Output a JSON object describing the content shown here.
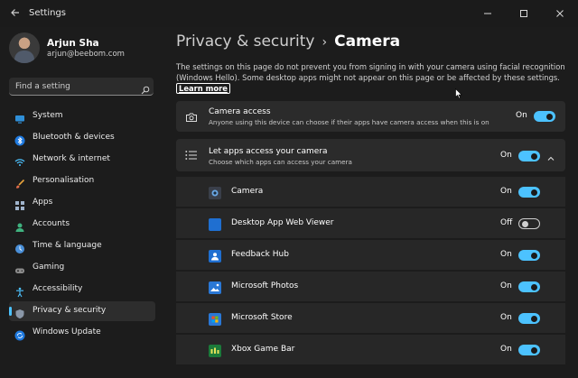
{
  "window": {
    "title": "Settings"
  },
  "user": {
    "name": "Arjun Sha",
    "email": "arjun@beebom.com"
  },
  "search": {
    "placeholder": "Find a setting"
  },
  "sidebar": {
    "items": [
      {
        "label": "System",
        "icon": "monitor-icon"
      },
      {
        "label": "Bluetooth & devices",
        "icon": "bluetooth-icon"
      },
      {
        "label": "Network & internet",
        "icon": "wifi-icon"
      },
      {
        "label": "Personalisation",
        "icon": "brush-icon"
      },
      {
        "label": "Apps",
        "icon": "apps-grid-icon"
      },
      {
        "label": "Accounts",
        "icon": "person-icon"
      },
      {
        "label": "Time & language",
        "icon": "globe-clock-icon"
      },
      {
        "label": "Gaming",
        "icon": "gamepad-icon"
      },
      {
        "label": "Accessibility",
        "icon": "accessibility-icon"
      },
      {
        "label": "Privacy & security",
        "icon": "shield-icon",
        "active": true
      },
      {
        "label": "Windows Update",
        "icon": "update-icon"
      }
    ]
  },
  "breadcrumb": {
    "parent": "Privacy & security",
    "separator": "›",
    "current": "Camera"
  },
  "description": {
    "text": "The settings on this page do not prevent you from signing in with your camera using facial recognition (Windows Hello). Some desktop apps might not appear on this page or be affected by these settings.",
    "link": "Learn more"
  },
  "camera_access": {
    "title": "Camera access",
    "subtitle": "Anyone using this device can choose if their apps have camera access when this is on",
    "state": "On"
  },
  "apps_access": {
    "title": "Let apps access your camera",
    "subtitle": "Choose which apps can access your camera",
    "state": "On"
  },
  "apps": [
    {
      "name": "Camera",
      "state": "On",
      "on": true,
      "color": "#3a3f4a"
    },
    {
      "name": "Desktop App Web Viewer",
      "state": "Off",
      "on": false,
      "color": "#1f6fd1"
    },
    {
      "name": "Feedback Hub",
      "state": "On",
      "on": true,
      "color": "#1f6fd1"
    },
    {
      "name": "Microsoft Photos",
      "state": "On",
      "on": true,
      "color": "#2a78d6"
    },
    {
      "name": "Microsoft Store",
      "state": "On",
      "on": true,
      "color": "#2a78d6"
    },
    {
      "name": "Xbox Game Bar",
      "state": "On",
      "on": true,
      "color": "#1c7a3a"
    }
  ],
  "colors": {
    "accent": "#4cc2ff",
    "background": "#1c1c1c",
    "card": "#2b2b2b"
  }
}
